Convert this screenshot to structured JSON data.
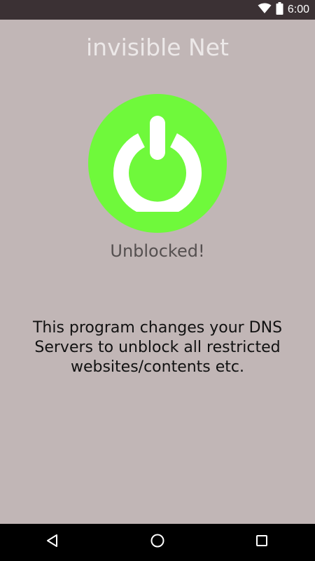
{
  "status_bar": {
    "time": "6:00",
    "icons": [
      "wifi-icon",
      "battery-icon"
    ]
  },
  "app": {
    "title": "invisible Net",
    "power_button": {
      "icon": "power-icon",
      "color": "#6ff93b",
      "icon_color": "#ffffff"
    },
    "status_text": "Unblocked!",
    "description": "This program changes your DNS Servers to unblock all restricted websites/contents etc."
  },
  "nav_bar": {
    "buttons": [
      "back-icon",
      "home-icon",
      "recents-icon"
    ]
  },
  "colors": {
    "background": "#c1b6b6",
    "status_bar": "#3b3134",
    "nav_bar": "#000000",
    "accent": "#6ff93b"
  }
}
